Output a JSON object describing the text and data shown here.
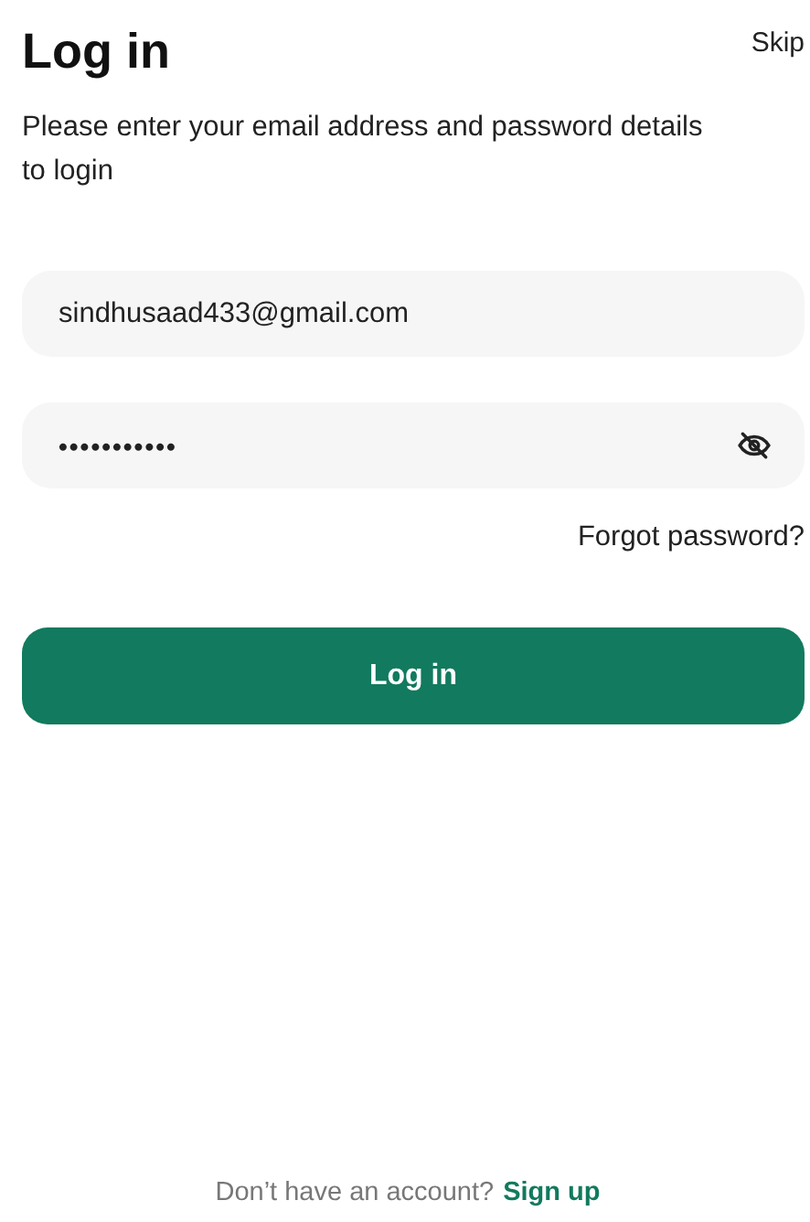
{
  "header": {
    "title": "Log in",
    "skip": "Skip"
  },
  "subtitle": "Please enter your email address and password details to login",
  "fields": [
    {
      "kind": "email",
      "value": "sindhusaad433@gmail.com"
    },
    {
      "kind": "password",
      "value": "•••••••••••"
    }
  ],
  "forgot_link": "Forgot password?",
  "login_button": "Log in",
  "footer": {
    "prompt": "Don’t have an account?",
    "link": "Sign up"
  }
}
